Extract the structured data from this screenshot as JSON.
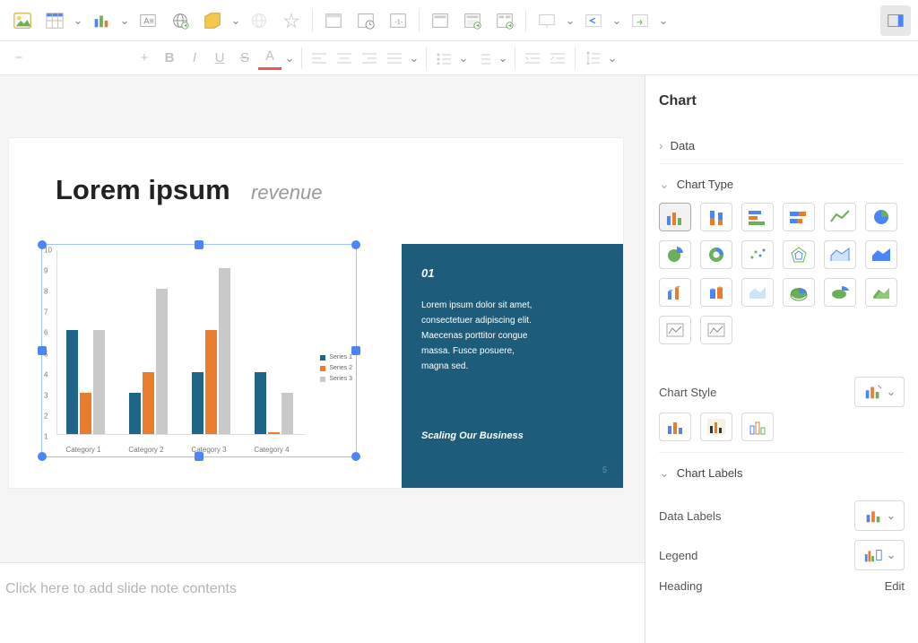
{
  "toolbar1": {
    "items": [
      {
        "name": "insert-image-icon"
      },
      {
        "name": "insert-table-icon",
        "dd": true
      },
      {
        "name": "insert-chart-icon",
        "dd": true
      },
      {
        "name": "insert-textbox-icon"
      },
      {
        "name": "insert-hyperlink-icon"
      },
      {
        "name": "insert-shape-icon",
        "dd": true
      },
      {
        "name": "insert-globe-disabled-icon"
      },
      {
        "name": "insert-effects-icon"
      },
      {
        "name": "insert-header-footer-icon"
      },
      {
        "name": "insert-date-time-icon"
      },
      {
        "name": "insert-slide-number-icon"
      },
      {
        "name": "layout-title-icon"
      },
      {
        "name": "layout-content-icon"
      },
      {
        "name": "layout-media-icon"
      },
      {
        "name": "present-from-start-icon",
        "dd": true
      },
      {
        "name": "previous-slide-icon",
        "dd": true
      },
      {
        "name": "next-slide-icon",
        "dd": true
      },
      {
        "name": "show-side-panel-icon",
        "active": true
      }
    ]
  },
  "toolbar2": {
    "items": [
      {
        "name": "remove",
        "glyph": "−"
      },
      {
        "name": "add",
        "glyph": "+"
      },
      {
        "name": "bold",
        "glyph": "B"
      },
      {
        "name": "italic",
        "glyph": "I"
      },
      {
        "name": "underline",
        "glyph": "U"
      },
      {
        "name": "strike",
        "glyph": "S"
      },
      {
        "name": "font-color",
        "glyph": "A"
      },
      {
        "name": "align-left",
        "glyph": "≡"
      },
      {
        "name": "align-center",
        "glyph": "≡"
      },
      {
        "name": "align-right",
        "glyph": "≡"
      },
      {
        "name": "align-justify",
        "glyph": "≡"
      },
      {
        "name": "bullet-list",
        "glyph": "⋮≡"
      },
      {
        "name": "number-list",
        "glyph": "1≡"
      },
      {
        "name": "indent-less",
        "glyph": "⇤"
      },
      {
        "name": "indent-more",
        "glyph": "⇥"
      },
      {
        "name": "line-spacing",
        "glyph": "↕"
      }
    ]
  },
  "slide": {
    "title": "Lorem ipsum",
    "subtitle": "revenue",
    "bluebox": {
      "number": "01",
      "body": "Lorem ipsum dolor sit amet, consectetuer adipiscing elit. Maecenas porttitor congue massa. Fusce posuere, magna sed.",
      "tagline": "Scaling Our Business",
      "page": "5"
    }
  },
  "chart_data": {
    "type": "bar",
    "categories": [
      "Category 1",
      "Category 2",
      "Category 3",
      "Category 4"
    ],
    "series": [
      {
        "name": "Series 1",
        "color": "#1f6587",
        "values": [
          6,
          3,
          4,
          4
        ]
      },
      {
        "name": "Series 2",
        "color": "#e77d2d",
        "values": [
          3,
          4,
          6,
          1
        ]
      },
      {
        "name": "Series 3",
        "color": "#c9c9c9",
        "values": [
          6,
          8,
          9,
          3
        ]
      }
    ],
    "ylim": [
      1,
      10
    ],
    "yticks": [
      1,
      2,
      3,
      4,
      5,
      6,
      7,
      8,
      9,
      10
    ],
    "xlabel": "",
    "ylabel": "",
    "title": ""
  },
  "notes": {
    "placeholder": "Click here to add slide note contents"
  },
  "side": {
    "title": "Chart",
    "sections": {
      "data": "Data",
      "chart_type": "Chart Type",
      "chart_style": "Chart Style",
      "chart_labels": "Chart Labels",
      "data_labels": "Data Labels",
      "legend": "Legend",
      "heading": "Heading",
      "edit": "Edit"
    },
    "chart_types": [
      "clustered-column",
      "stacked-column",
      "clustered-bar",
      "stacked-bar",
      "line",
      "pie",
      "exploded-pie",
      "doughnut",
      "scatter",
      "radar",
      "area",
      "filled-area",
      "3d-column",
      "3d-cylinder",
      "3d-area",
      "3d-pie",
      "3d-exploded-pie",
      "3d-surface",
      "image-chart-a",
      "image-chart-b"
    ],
    "chart_styles": [
      "style-1",
      "style-2",
      "style-3"
    ]
  }
}
